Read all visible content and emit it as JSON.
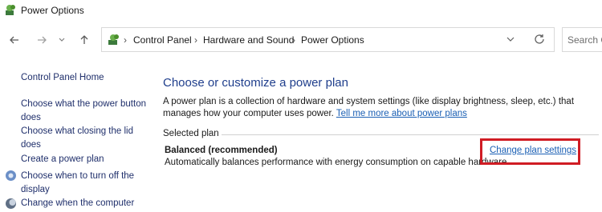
{
  "window": {
    "title": "Power Options"
  },
  "address_bar": {
    "breadcrumbs": [
      "Control Panel",
      "Hardware and Sound",
      "Power Options"
    ],
    "search_placeholder": "Search C"
  },
  "left_pane": {
    "home": "Control Panel Home",
    "links": [
      {
        "line1": "Choose what the power button",
        "line2": "does"
      },
      {
        "line1": "Choose what closing the lid",
        "line2": "does"
      },
      {
        "line1": "Create a power plan",
        "line2": ""
      },
      {
        "line1": "Choose when to turn off the",
        "line2": "display"
      },
      {
        "line1": "Change when the computer",
        "line2": ""
      }
    ]
  },
  "main": {
    "title": "Choose or customize a power plan",
    "description": "A power plan is a collection of hardware and system settings (like display brightness, sleep, etc.) that manages how your computer uses power.",
    "learn_more_link": "Tell me more about power plans",
    "selected_plan_label": "Selected plan",
    "plan_name": "Balanced (recommended)",
    "plan_description": "Automatically balances performance with energy consumption on capable hardware.",
    "change_settings_link": "Change plan settings"
  },
  "colors": {
    "highlight": "#d01c24",
    "link": "#1a5fb4",
    "heading": "#1f3e8c"
  }
}
